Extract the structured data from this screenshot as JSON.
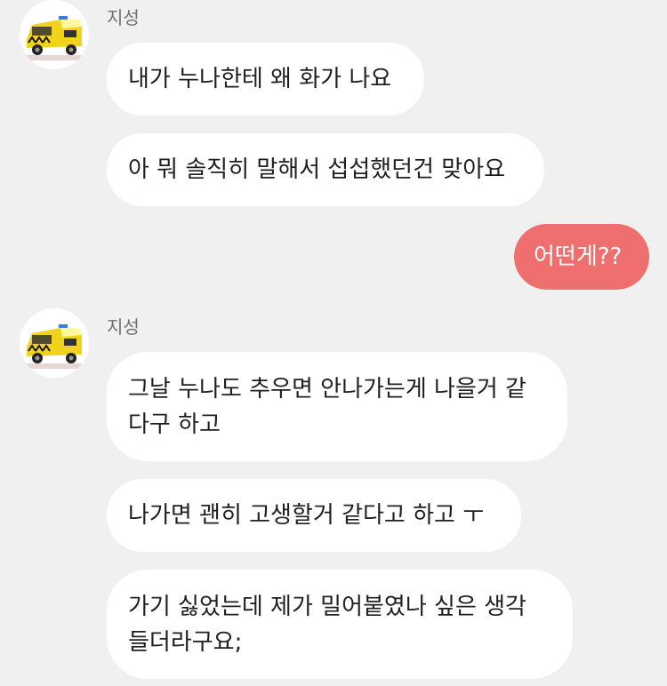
{
  "groups": [
    {
      "sender": "지성",
      "avatar_icon": "ambulance-toy-icon",
      "messages": [
        "내가 누나한테 왜 화가 나요",
        "아 뭐 솔직히 말해서 섭섭했던건 맞아요"
      ]
    },
    {
      "sender": "지성",
      "avatar_icon": "ambulance-toy-icon",
      "messages": [
        "그날 누나도 추우면 안나가는게 나을거 같다구 하고",
        "나가면 괜히 고생할거 같다고 하고 ㅜ",
        "가기 싫었는데 제가 밀어붙였나 싶은 생각 들더라구요;"
      ]
    }
  ],
  "outgoing": [
    "어떤게??"
  ],
  "colors": {
    "background": "#f0f0f0",
    "incoming_bubble": "#ffffff",
    "outgoing_bubble": "#ee6f6e"
  }
}
